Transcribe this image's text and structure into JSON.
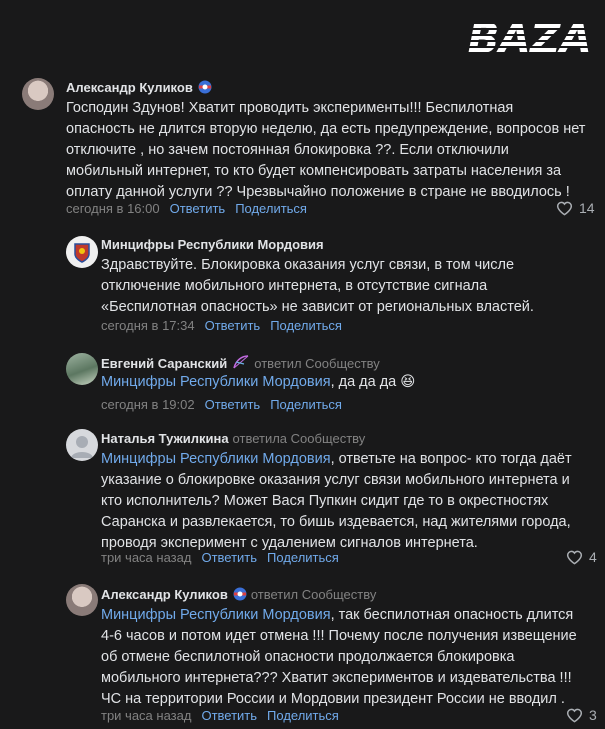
{
  "brand": {
    "logo_text": "BAZA"
  },
  "comments": [
    {
      "author": "Александр Куликов",
      "replied_to": "",
      "text": "Господин Здунов! Хватит проводить эксперименты!!! Беспилотная опасность не длится вторую неделю, да есть предупреждение, вопросов нет отключите , но зачем постоянная блокировка ??. Если отключили мобильный интернет, то кто будет компенсировать затраты населения за оплату данной услуги ?? Чрезвычайно положение в стране не вводилось !",
      "time": "сегодня в 16:00",
      "reply": "Ответить",
      "share": "Поделиться",
      "likes": "14"
    },
    {
      "author": "Минцифры Республики Мордовия",
      "replied_to": "",
      "text": "Здравствуйте. Блокировка оказания услуг связи, в том числе отключение мобильного интернета, в отсутствие сигнала «Беспилотная опасность» не зависит от региональных властей.",
      "time": "сегодня в 17:34",
      "reply": "Ответить",
      "share": "Поделиться",
      "likes": ""
    },
    {
      "author": "Евгений Саранский",
      "replied_to": "ответил Сообществу",
      "mention": "Минцифры Республики Мордовия",
      "text": ", да да да 😆",
      "time": "сегодня в 19:02",
      "reply": "Ответить",
      "share": "Поделиться",
      "likes": ""
    },
    {
      "author": "Наталья Тужилкина",
      "replied_to": "ответила Сообществу",
      "mention": "Минцифры Республики Мордовия",
      "text": ", ответьте на вопрос- кто тогда даёт указание о блокировке оказания услуг связи мобильного интернета и кто исполнитель? Может Вася Пупкин сидит где то в окрестностях Саранска и развлекается, то бишь издевается, над жителями города, проводя эксперимент с удалением сигналов интернета.",
      "time": "три часа назад",
      "reply": "Ответить",
      "share": "Поделиться",
      "likes": "4"
    },
    {
      "author": "Александр Куликов",
      "replied_to": "ответил Сообществу",
      "mention": "Минцифры Республики Мордовия",
      "text": ", так беспилотная опасность длится 4-6 часов и потом идет отмена !!! Почему после получения извещение об отмене беспилотной опасности продолжается блокировка мобильного интернета??? Хватит экспериментов и издевательства !!! ЧС на территории России и Мордовии президент России не вводил .",
      "time": "три часа назад",
      "reply": "Ответить",
      "share": "Поделиться",
      "likes": "3"
    }
  ]
}
